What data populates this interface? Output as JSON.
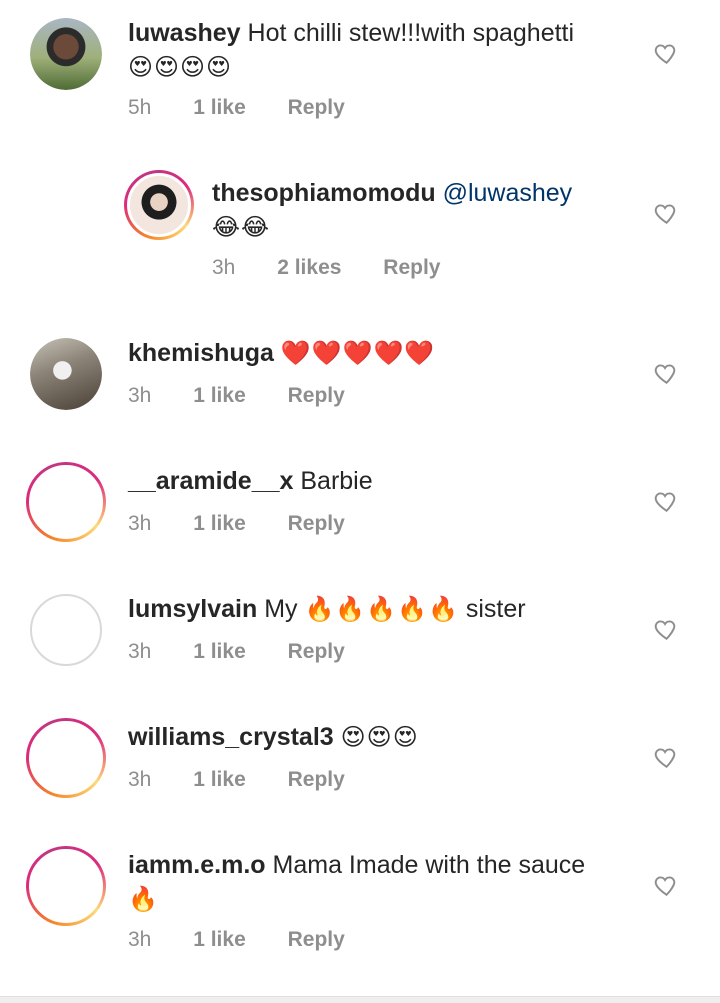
{
  "comments": [
    {
      "username": "luwashey",
      "text": "Hot chilli stew!!!with spaghetti",
      "emoji": "😍😍😍😍",
      "time": "5h",
      "likes": "1 like",
      "reply": "Reply"
    },
    {
      "username": "thesophiamomodu",
      "mention": "@luwashey",
      "emoji": "😂😂",
      "time": "3h",
      "likes": "2 likes",
      "reply": "Reply"
    },
    {
      "username": "khemishuga",
      "emoji": "❤️❤️❤️❤️❤️",
      "time": "3h",
      "likes": "1 like",
      "reply": "Reply"
    },
    {
      "username": "__aramide__x",
      "text": "Barbie",
      "time": "3h",
      "likes": "1 like",
      "reply": "Reply"
    },
    {
      "username": "lumsylvain",
      "text_before": "My",
      "emoji": "🔥🔥🔥🔥🔥",
      "text_after": "sister",
      "time": "3h",
      "likes": "1 like",
      "reply": "Reply"
    },
    {
      "username": "williams_crystal3",
      "emoji": "😍😍😍",
      "time": "3h",
      "likes": "1 like",
      "reply": "Reply"
    },
    {
      "username": "iamm.e.m.o",
      "text": "Mama Imade with the sauce",
      "emoji": "🔥",
      "time": "3h",
      "likes": "1 like",
      "reply": "Reply"
    }
  ],
  "colors": {
    "username": "#262626",
    "meta": "#8e8e8e",
    "mention": "#003569",
    "heart_outline": "#8e8e8e"
  },
  "icons": {
    "like": "heart-outline-icon"
  }
}
